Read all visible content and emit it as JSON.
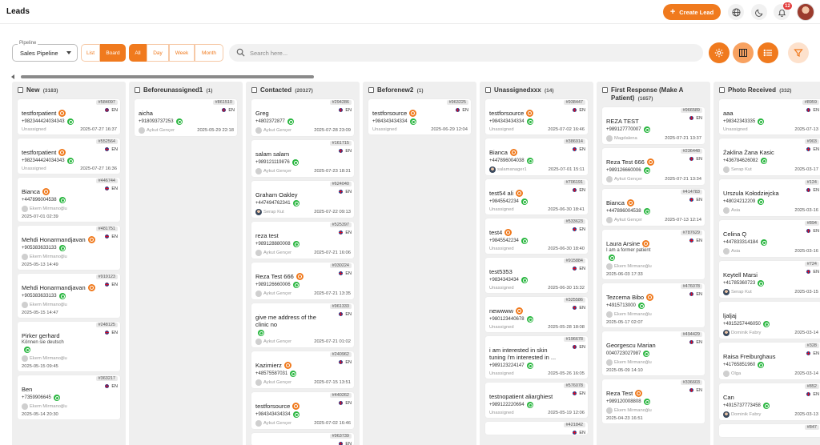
{
  "header": {
    "title": "Leads",
    "create_label": "Create Lead",
    "notification_count": "12"
  },
  "toolbar": {
    "pipeline_label": "Pipeline",
    "pipeline_value": "Sales Pipeline",
    "view_tabs": [
      "List",
      "Board"
    ],
    "active_view": "Board",
    "range_tabs": [
      "All",
      "Day",
      "Week",
      "Month"
    ],
    "active_range": "All",
    "search_placeholder": "Search here..."
  },
  "columns": [
    {
      "title": "New",
      "count": "(3183)",
      "cards": [
        {
          "id": "#584097",
          "lang": "EN",
          "name": "testforpatient",
          "source": true,
          "phone": "+982344424034343",
          "owner": "Unassigned",
          "date": "2025-07-27 16:37"
        },
        {
          "id": "#552564",
          "lang": "EN",
          "name": "testforpatient",
          "source": true,
          "phone": "+982344424034343",
          "owner": "Unassigned",
          "date": "2025-07-27 16:36"
        },
        {
          "id": "#446744",
          "lang": "EN",
          "name": "Bianca",
          "source": true,
          "phone": "+447896004538",
          "owner": "Ekem Mirmanoğlu",
          "date": "2025-07-01 02:39",
          "stack": true
        },
        {
          "id": "#481751",
          "lang": "EN",
          "name": "Mehdi Honarmandjavan",
          "source": true,
          "phone": "+905383633133",
          "owner": "Ekem Mirmanoğlu",
          "date": "2025-05-13 14:49",
          "stack": true
        },
        {
          "id": "#919123",
          "lang": "EN",
          "name": "Mehdi Honarmandjavan",
          "source": true,
          "phone": "+905383633133",
          "owner": "Ekem Mirmanoğlu",
          "date": "2025-05-15 14:47",
          "stack": true
        },
        {
          "id": "#248125",
          "lang": "EN",
          "name": "Pirker gerhard",
          "note": "Können sie deutsch",
          "phone": "",
          "owner": "Ekem Mirmanoğlu",
          "date": "2025-05-15 09:45",
          "stack": true
        },
        {
          "id": "#363217",
          "lang": "EN",
          "name": "Ben",
          "phone": "+7359906645",
          "owner": "Ekem Mirmanoğlu",
          "date": "2025-05-14 20:30",
          "stack": true
        }
      ]
    },
    {
      "title": "Beforeunassigned1",
      "count": "(1)",
      "cards": [
        {
          "id": "#861510",
          "lang": "EN",
          "name": "aicha",
          "phone": "+918093737253",
          "owner": "Aykut Gençer",
          "date": "2025-05-29 22:18"
        }
      ]
    },
    {
      "title": "Contacted",
      "count": "(20327)",
      "cards": [
        {
          "id": "#294286",
          "lang": "EN",
          "name": "Greg",
          "phone": "+4802372877",
          "owner": "Aykut Gençer",
          "date": "2025-07-28 23:09"
        },
        {
          "id": "#161715",
          "lang": "EN",
          "name": "salam salam",
          "phone": "+989121119876",
          "owner": "Aykut Gençer",
          "date": "2025-07-23 18:31"
        },
        {
          "id": "#624040",
          "lang": "EN",
          "name": "Graham Oakley",
          "phone": "+447494762341",
          "owner": "Serap Kut",
          "date": "2025-07-22 09:13",
          "photo": true
        },
        {
          "id": "#525397",
          "lang": "EN",
          "name": "reza test",
          "phone": "+989128880008",
          "owner": "Aykut Gençer",
          "date": "2025-07-21 16:06"
        },
        {
          "id": "#030224",
          "lang": "EN",
          "name": "Reza Test 666",
          "source": true,
          "phone": "+989126660006",
          "owner": "Aykut Gençer",
          "date": "2025-07-21 13:35"
        },
        {
          "id": "#961333",
          "lang": "EN",
          "name": "give me address of the clinic no",
          "phone": "",
          "owner": "Aykut Gençer",
          "date": "2025-07-21 01:02"
        },
        {
          "id": "#240962",
          "lang": "EN",
          "name": "Kazimierz",
          "source": true,
          "phone": "+48575587031",
          "owner": "Aykut Gençer",
          "date": "2025-07-15 13:51"
        },
        {
          "id": "#440262",
          "lang": "EN",
          "name": "testforsource",
          "source": true,
          "phone": "+984343434334",
          "owner": "Aykut Gençer",
          "date": "2025-07-02 16:46"
        },
        {
          "id": "#963739",
          "lang": "EN",
          "name": "",
          "phone": "",
          "owner": "",
          "date": ""
        }
      ]
    },
    {
      "title": "Beforenew2",
      "count": "(1)",
      "cards": [
        {
          "id": "#963225",
          "lang": "EN",
          "name": "testforsource",
          "source": true,
          "phone": "+984343434334",
          "owner": "Unassigned",
          "date": "2025-06-29 12:04"
        }
      ]
    },
    {
      "title": "Unassignedxxx",
      "count": "(14)",
      "cards": [
        {
          "id": "#938447",
          "lang": "EN",
          "name": "testforsource",
          "source": true,
          "phone": "+984343434334",
          "owner": "Unassigned",
          "date": "2025-07-02 16:46"
        },
        {
          "id": "#386914",
          "lang": "EN",
          "name": "Bianca",
          "source": true,
          "phone": "+447896004038",
          "owner": "salamanager1",
          "date": "2025-07-01 15:11",
          "photo": true
        },
        {
          "id": "#706191",
          "lang": "EN",
          "name": "test54 ali",
          "source": true,
          "phone": "+9845542234",
          "owner": "Unassigned",
          "date": "2025-06-30 18:41"
        },
        {
          "id": "#533623",
          "lang": "EN",
          "name": "test4",
          "source": true,
          "phone": "+9845542234",
          "owner": "Unassigned",
          "date": "2025-06-30 18:40"
        },
        {
          "id": "#915884",
          "lang": "EN",
          "name": "test5353",
          "phone": "+9834343434",
          "owner": "Unassigned",
          "date": "2025-06-30 15:32"
        },
        {
          "id": "#325586",
          "lang": "EN",
          "name": "newwww",
          "source": true,
          "phone": "+980123440678",
          "owner": "Unassigned",
          "date": "2025-05-28 18:08"
        },
        {
          "id": "#196678",
          "lang": "EN",
          "name": "i am interested in skin tuning i'm interested in ...",
          "phone": "+989123224147",
          "owner": "Unassigned",
          "date": "2025-05-26 16:05"
        },
        {
          "id": "#576078",
          "lang": "EN",
          "name": "testnopatient aliarghiest",
          "phone": "+989122220694",
          "owner": "Unassigned",
          "date": "2025-05-19 12:06"
        },
        {
          "id": "#421842",
          "lang": "EN",
          "name": "",
          "phone": "",
          "owner": "",
          "date": ""
        }
      ]
    },
    {
      "title": "First Response (Make A Patient)",
      "count": "(1657)",
      "cards": [
        {
          "id": "#966589",
          "lang": "EN",
          "name": "REZA TEST",
          "phone": "+989127770007",
          "owner": "Magdalena",
          "date": "2025-07-21 13:37"
        },
        {
          "id": "#236448",
          "lang": "EN",
          "name": "Reza Test 666",
          "source": true,
          "phone": "+989126660006",
          "owner": "Aykut Gençer",
          "date": "2025-07-21 13:34"
        },
        {
          "id": "#414783",
          "lang": "EN",
          "name": "Bianca",
          "source": true,
          "phone": "+447896004538",
          "owner": "Aykut Gençer",
          "date": "2025-07-13 12:14"
        },
        {
          "id": "#787629",
          "lang": "EN",
          "name": "Laura Arsine",
          "source": true,
          "note": "I am a former patient",
          "phone": "",
          "owner": "Ekem Mirmanoğlu",
          "date": "2025-06-03 17:33",
          "stack": true
        },
        {
          "id": "#476078",
          "lang": "EN",
          "name": "Tezcema Bibo",
          "source": true,
          "phone": "+4915713000",
          "owner": "Ekem Mirmanoğlu",
          "date": "2025-05-17 02:07",
          "stack": true
        },
        {
          "id": "#494429",
          "lang": "EN",
          "name": "Georgescu Marian",
          "phone": "0040723027987",
          "owner": "Ekem Mirmanoğlu",
          "date": "2025-05-09 14:10",
          "stack": true
        },
        {
          "id": "#336603",
          "lang": "EN",
          "name": "Reza Test",
          "source": true,
          "phone": "+989120008808",
          "owner": "Ekem Mirmanoğlu",
          "date": "2025-04-23 16:51",
          "stack": true
        }
      ]
    },
    {
      "title": "Photo Received",
      "count": "(332)",
      "cards": [
        {
          "id": "#8959",
          "lang": "EN",
          "name": "aaa",
          "phone": "+98342343335",
          "owner": "Unassigned",
          "date": "2025-07-13"
        },
        {
          "id": "#903",
          "lang": "EN",
          "name": "Żaklina Żana Kasic",
          "phone": "+436784626082",
          "owner": "Serap Kut",
          "date": "2025-03-17"
        },
        {
          "id": "#124",
          "lang": "EN",
          "name": "Urszula Kołodziejcka",
          "phone": "+48024212209",
          "owner": "Asia",
          "date": "2025-03-16"
        },
        {
          "id": "#894",
          "lang": "EN",
          "name": "Celina Q",
          "phone": "+447833314184",
          "owner": "Asia",
          "date": "2025-03-16"
        },
        {
          "id": "#724",
          "lang": "EN",
          "name": "Keytell Marsi",
          "phone": "+41785360723",
          "owner": "Serap Kut",
          "date": "2025-03-15",
          "photo": true
        },
        {
          "id": "",
          "lang": "",
          "name": "ljaljaj",
          "phone": "+4915257446050",
          "owner": "Dominik Fabry",
          "date": "2025-03-14",
          "photo": true
        },
        {
          "id": "#328",
          "lang": "EN",
          "name": "Raisa Freiburghaus",
          "phone": "+41765851960",
          "owner": "Olga",
          "date": "2025-03-14"
        },
        {
          "id": "#852",
          "lang": "EN",
          "name": "Can",
          "phone": "+4915737773458",
          "owner": "Dominik Fabry",
          "date": "2025-03-13",
          "photo": true
        },
        {
          "id": "#847",
          "lang": "",
          "name": "",
          "phone": "",
          "owner": "",
          "date": ""
        }
      ]
    }
  ]
}
